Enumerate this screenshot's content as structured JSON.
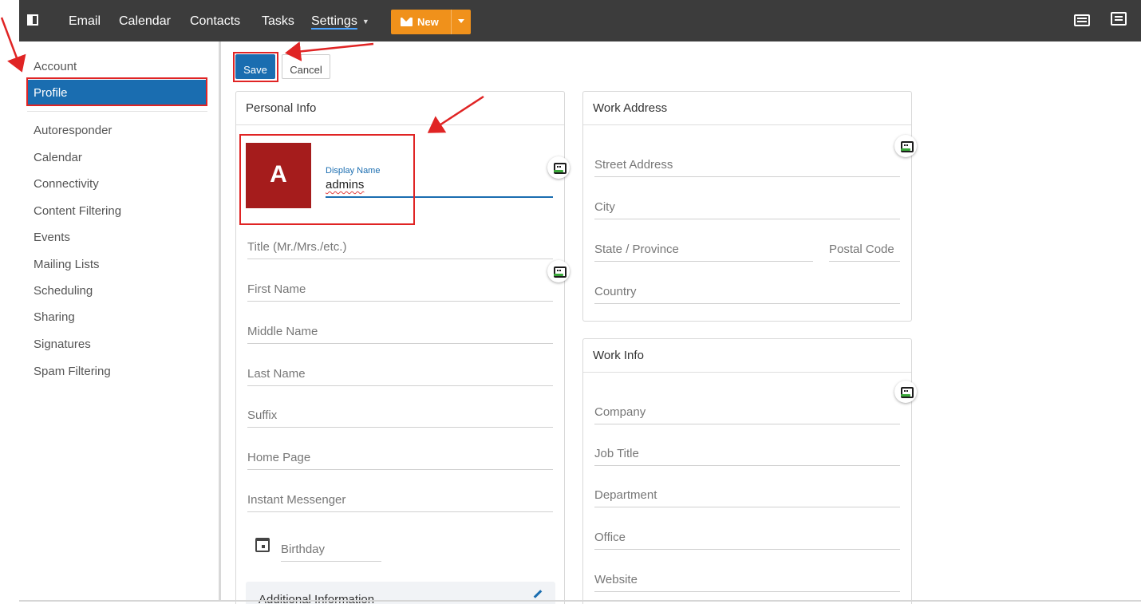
{
  "topbar": {
    "nav": [
      "Email",
      "Calendar",
      "Contacts",
      "Tasks"
    ],
    "settings_label": "Settings",
    "new_label": "New",
    "icons": [
      "panel-toggle-icon",
      "mail-icon",
      "keyboard-icon",
      "chat-icon"
    ]
  },
  "sidebar": {
    "items": [
      "Account",
      "Profile",
      "Autoresponder",
      "Calendar",
      "Connectivity",
      "Content Filtering",
      "Events",
      "Mailing Lists",
      "Scheduling",
      "Sharing",
      "Signatures",
      "Spam Filtering"
    ],
    "active": "Profile"
  },
  "toolbar": {
    "save_label": "Save",
    "cancel_label": "Cancel"
  },
  "personal_info": {
    "title": "Personal Info",
    "avatar_letter": "A",
    "display_name_label": "Display Name",
    "display_name_value": "admins",
    "fields": [
      "Title (Mr./Mrs./etc.)",
      "First Name",
      "Middle Name",
      "Last Name",
      "Suffix",
      "Home Page",
      "Instant Messenger"
    ],
    "birthday": "Birthday",
    "additional_info": "Additional Information"
  },
  "work_address": {
    "title": "Work Address",
    "street": "Street Address",
    "city": "City",
    "state": "State / Province",
    "postal": "Postal Code",
    "country": "Country"
  },
  "work_info": {
    "title": "Work Info",
    "fields": [
      "Company",
      "Job Title",
      "Department",
      "Office",
      "Website"
    ]
  },
  "colors": {
    "accent": "#1a6db0",
    "topbar": "#3c3c3c",
    "new_button": "#f0911b",
    "avatar": "#a51c1c",
    "annotation": "#e02424"
  }
}
